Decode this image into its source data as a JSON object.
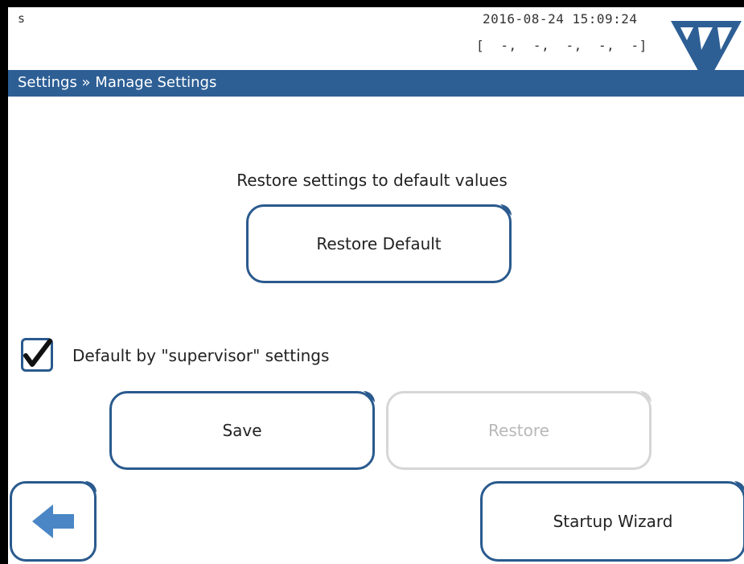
{
  "status": {
    "user": "s",
    "datetime": "2016-08-24 15:09:24",
    "indicators": "[  -,  -,  -,  -,  -]"
  },
  "header": {
    "breadcrumb": "Settings » Manage Settings"
  },
  "main": {
    "heading": "Restore settings to default values",
    "restore_default_label": "Restore Default",
    "checkbox": {
      "label": "Default by \"supervisor\" settings",
      "checked": true
    },
    "save_label": "Save",
    "restore_label": "Restore",
    "restore_enabled": false
  },
  "footer": {
    "back_icon": "left-arrow-icon",
    "startup_wizard_label": "Startup Wizard"
  },
  "colors": {
    "accent": "#2d5f95",
    "disabled": "#d6d6d6"
  }
}
